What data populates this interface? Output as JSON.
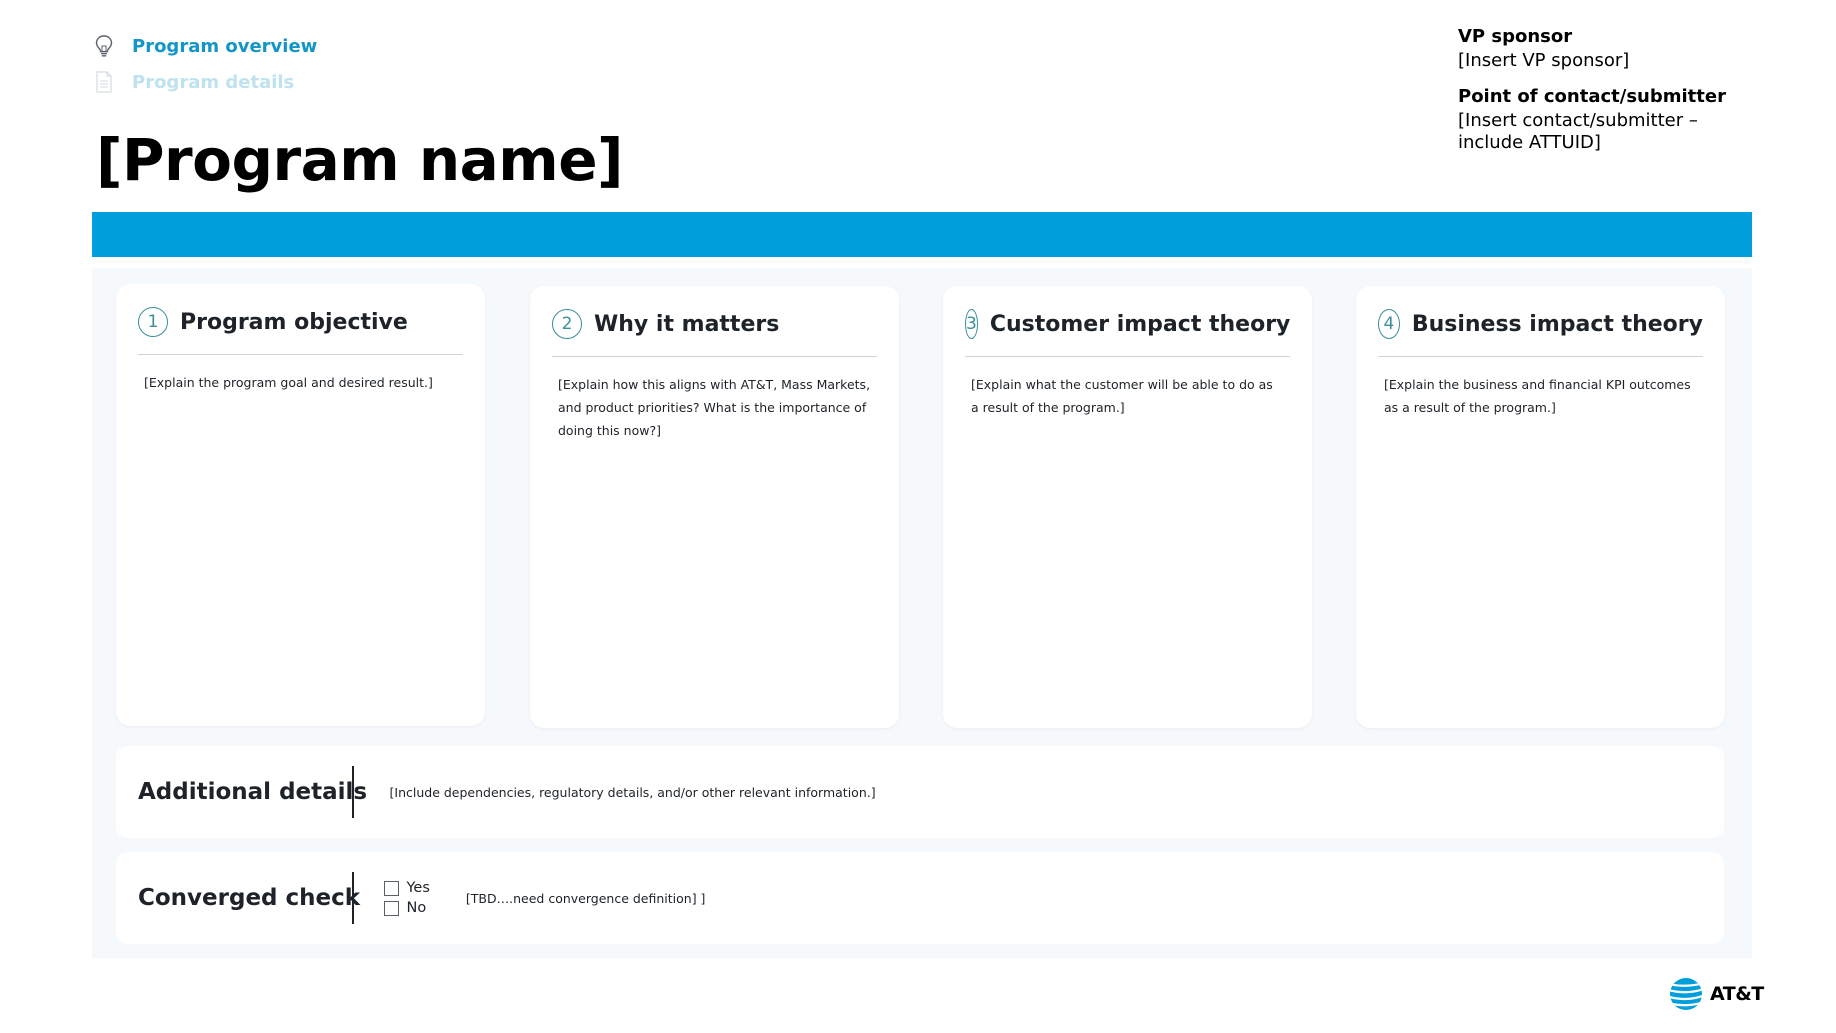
{
  "nav": {
    "items": [
      {
        "label": "Program overview",
        "icon": "lightbulb-icon",
        "state": "active"
      },
      {
        "label": "Program details",
        "icon": "document-icon",
        "state": "inactive"
      }
    ]
  },
  "page_title": "[Program name]",
  "sponsor": {
    "vp_label": "VP sponsor",
    "vp_value": "[Insert VP sponsor]",
    "contact_label": "Point of contact/submitter",
    "contact_value_line1": "[Insert contact/submitter –",
    "contact_value_line2": "include ATTUID]"
  },
  "cards": [
    {
      "num": "1",
      "title": "Program objective",
      "body": "[Explain the program goal and desired result.]"
    },
    {
      "num": "2",
      "title": "Why it matters",
      "body": "[Explain how this aligns with AT&T, Mass Markets, and product priorities? What is the importance of doing this now?]"
    },
    {
      "num": "3",
      "title": "Customer impact theory",
      "body": "[Explain what the customer will be able to do as a result of the program.]"
    },
    {
      "num": "4",
      "title": "Business impact theory",
      "body": "[Explain the business and financial KPI outcomes as a result of the program.]"
    }
  ],
  "additional": {
    "label": "Additional details",
    "text": "[Include dependencies, regulatory details, and/or other relevant information.]"
  },
  "converged": {
    "label": "Converged check",
    "yes": "Yes",
    "no": "No",
    "text": "[TBD….need convergence definition] ]"
  },
  "brand": {
    "name": "AT&T",
    "icon": "att-globe-icon"
  },
  "colors": {
    "accent": "#009fdb",
    "nav_active": "#1495c7",
    "nav_inactive": "#bfe2f0",
    "panel_bg": "#f5f9fc"
  }
}
